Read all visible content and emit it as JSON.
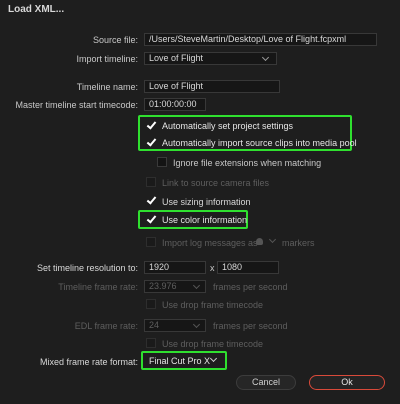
{
  "window": {
    "title": "Load XML..."
  },
  "source_file": {
    "label": "Source file:",
    "value": "/Users/SteveMartin/Desktop/Love of Flight.fcpxml"
  },
  "import_timeline": {
    "label": "Import timeline:",
    "value": "Love of Flight"
  },
  "timeline_name": {
    "label": "Timeline name:",
    "value": "Love of Flight"
  },
  "start_tc": {
    "label": "Master timeline start timecode:",
    "value": "01:00:00:00"
  },
  "options": {
    "auto_project": "Automatically set project settings",
    "auto_import": "Automatically import source clips into media pool",
    "ignore_ext": "Ignore file extensions when matching",
    "link_camera": "Link to source camera files",
    "sizing": "Use sizing information",
    "color": "Use color information",
    "import_log": "Import log messages as",
    "markers": "markers"
  },
  "resolution": {
    "label": "Set timeline resolution to:",
    "width": "1920",
    "sep": "x",
    "height": "1080"
  },
  "timeline_fps": {
    "label": "Timeline frame rate:",
    "value": "23.976",
    "unit": "frames per second",
    "drop": "Use drop frame timecode"
  },
  "edl_fps": {
    "label": "EDL frame rate:",
    "value": "24",
    "unit": "frames per second",
    "drop": "Use drop frame timecode"
  },
  "mixed_format": {
    "label": "Mixed frame rate format:",
    "value": "Final Cut Pro X"
  },
  "buttons": {
    "cancel": "Cancel",
    "ok": "Ok"
  },
  "colors": {
    "highlight": "#2fe02f",
    "ok_border": "#d94a3a",
    "background": "#1e1e1e"
  }
}
